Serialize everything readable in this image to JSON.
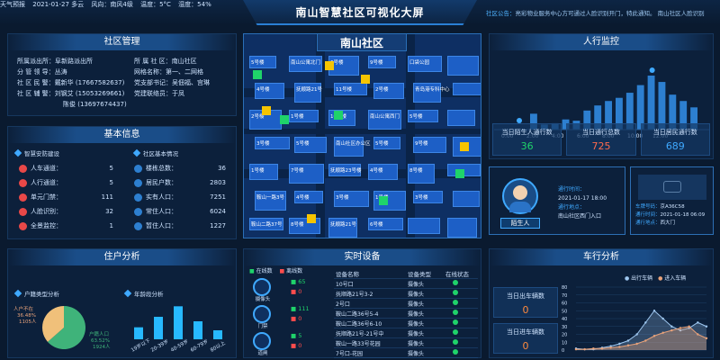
{
  "header": {
    "weather_label": "天气预报",
    "date_location": "2021-01-27 多云",
    "wind": "风向：南风4级",
    "temperature": "温度：5°C",
    "humidity": "湿度：54%",
    "title": "南山智慧社区可视化大屏",
    "notice_label": "社区公告：",
    "notice_text": "亮彩物业服务中心方可通过人脸识别开门，特此通知。  南山社区人脸识别"
  },
  "community_mgmt": {
    "title": "社区管理",
    "left": [
      {
        "label": "所属派出所：",
        "value": "阜新路派出所"
      },
      {
        "label": "分 管 领 导：",
        "value": "丛涛"
      },
      {
        "label": "社 区 民 警：",
        "value": "戴新华 (17667582637)"
      },
      {
        "label": "社 区 辅 警：",
        "value": "刘钢艾 (15053269661)"
      },
      {
        "label": "",
        "value": "陈俊 (13697674437)"
      }
    ],
    "right": [
      {
        "label": "所 属 社 区：",
        "value": "南山社区"
      },
      {
        "label": "网格名称：",
        "value": "第一、二网格"
      },
      {
        "label": "党支部书记：",
        "value": "吴佃福、宫琳"
      },
      {
        "label": "党建联络员：",
        "value": "于凤"
      }
    ]
  },
  "basic_info": {
    "title": "基本信息",
    "left_head": "智慧安防建设",
    "left": [
      {
        "label": "人车通道：",
        "value": "5"
      },
      {
        "label": "人行通道：",
        "value": "5"
      },
      {
        "label": "单元门禁：",
        "value": "111"
      },
      {
        "label": "人脸识别：",
        "value": "32"
      },
      {
        "label": "全景监控：",
        "value": "1"
      }
    ],
    "right_head": "社区基本情况",
    "right": [
      {
        "label": "楼栋总数：",
        "value": "36"
      },
      {
        "label": "居民户数：",
        "value": "2803"
      },
      {
        "label": "实有人口：",
        "value": "7251"
      },
      {
        "label": "常住人口：",
        "value": "6024"
      },
      {
        "label": "暂住人口：",
        "value": "1227"
      }
    ]
  },
  "map": {
    "title": "南山社区",
    "labels": [
      "5号楼",
      "4号楼",
      "2号楼",
      "3号楼",
      "1号楼",
      "鞍山一路3号",
      "鞍山二路37号",
      "南山公寓北门",
      "抚顺路21号",
      "1号楼",
      "5号楼",
      "7号楼",
      "4号楼",
      "8号楼",
      "6号楼",
      "11号楼",
      "10号楼",
      "南山社区办公区",
      "抚顺路23号楼",
      "3号楼",
      "抚顺路21号",
      "9号楼",
      "2号楼",
      "南山公寓西门",
      "5号楼",
      "4号楼",
      "1号楼",
      "6号楼",
      "口袋公园",
      "青岛港专科中心",
      "5号楼",
      "9号楼",
      "8号楼",
      "3号楼"
    ]
  },
  "pedestrian": {
    "title": "人行监控",
    "chart_data": {
      "type": "bar",
      "x": [
        "0:00",
        "2:00",
        "4:00",
        "6:00",
        "8:00",
        "10:00",
        "12:00"
      ],
      "values": [
        25,
        8,
        10,
        16,
        14,
        30,
        38,
        45,
        50,
        58,
        70,
        85,
        75,
        55,
        45,
        35
      ]
    },
    "cards": [
      {
        "label": "当日陌生人通行数",
        "value": "36"
      },
      {
        "label": "当日通行总数",
        "value": "725"
      },
      {
        "label": "当日居民通行数",
        "value": "689"
      }
    ],
    "person_label": "陌生人",
    "pass_time_label": "通行时间：",
    "pass_time": "2021-01-17 18:00",
    "pass_place_label": "通行地点：",
    "pass_place": "南山社区西门入口",
    "plate_label": "车牌号码：",
    "plate": "京A36C58",
    "car_time_label": "通行时间：",
    "car_time": "2021-01-18 06:09",
    "car_place_label": "通行地点：",
    "car_place": "西大门"
  },
  "household": {
    "title": "住户分析",
    "pie_head": "户籍类型分析",
    "pie": {
      "chart_data": {
        "type": "pie",
        "slices": [
          {
            "name": "户籍人口",
            "percent": 63.52,
            "count": 1924
          },
          {
            "name": "人户不在",
            "percent": 36.48,
            "count": 1105
          }
        ]
      },
      "label_a1": "人户不在",
      "label_a2": "36.48%",
      "label_a3": "1105人",
      "label_b1": "户籍人口",
      "label_b2": "63.52%",
      "label_b3": "1924人"
    },
    "bar_head": "年龄段分析",
    "bars": {
      "chart_data": {
        "type": "bar",
        "categories": [
          "19岁以下",
          "20-39岁",
          "40-59岁",
          "60-79岁",
          "80以上"
        ],
        "values": [
          40,
          75,
          110,
          60,
          30
        ]
      }
    }
  },
  "devices": {
    "title": "实时设备",
    "online": "在线数",
    "offline": "离线数",
    "groups": [
      {
        "name": "摄像头",
        "on": "65",
        "off": "0"
      },
      {
        "name": "门禁",
        "on": "111",
        "off": "0"
      },
      {
        "name": "道闸",
        "on": "5",
        "off": "0"
      }
    ],
    "headers": [
      "设备名称",
      "设备类型",
      "在线状态"
    ],
    "rows": [
      [
        "10号口",
        "摄像头"
      ],
      [
        "抚顺路21号3-2",
        "摄像头"
      ],
      [
        "2号口",
        "摄像头"
      ],
      [
        "鞍山二路36号5-4",
        "摄像头"
      ],
      [
        "鞍山二路36号6-10",
        "摄像头"
      ],
      [
        "抚顺路21号-21号中",
        "摄像头"
      ],
      [
        "鞍山一路33号花园",
        "摄像头"
      ],
      [
        "7号口-花园",
        "摄像头"
      ]
    ]
  },
  "vehicle": {
    "title": "车行分析",
    "out_label": "当日出车辆数",
    "out_value": "0",
    "in_label": "当日进车辆数",
    "in_value": "0",
    "legend_out": "出行车辆",
    "legend_in": "进入车辆",
    "chart_data": {
      "type": "area",
      "yticks": [
        "0",
        "10",
        "20",
        "30",
        "40",
        "50",
        "60",
        "70",
        "80"
      ],
      "series": [
        {
          "name": "出行车辆",
          "values": [
            2,
            1,
            1,
            3,
            5,
            8,
            12,
            20,
            35,
            50,
            40,
            30,
            25,
            28,
            35,
            30
          ]
        },
        {
          "name": "进入车辆",
          "values": [
            1,
            1,
            2,
            2,
            3,
            4,
            6,
            8,
            12,
            18,
            22,
            25,
            28,
            30,
            20,
            15
          ]
        }
      ]
    }
  }
}
